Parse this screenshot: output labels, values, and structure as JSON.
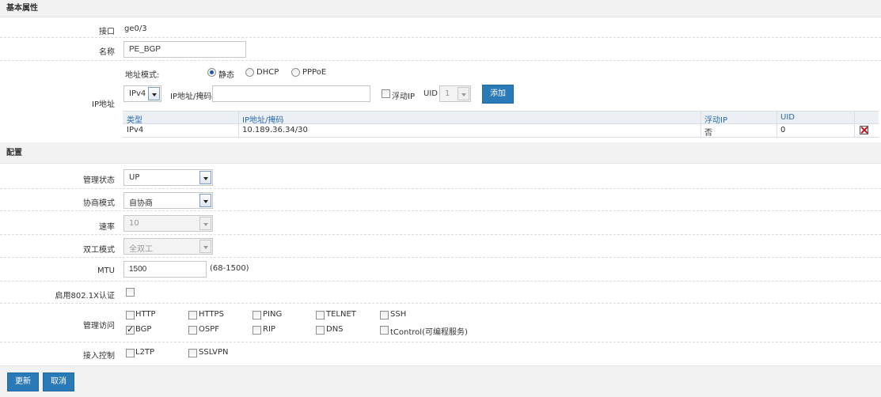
{
  "sections": {
    "basic": "基本属性",
    "config": "配置"
  },
  "interface": {
    "label": "接口",
    "value": "ge0/3"
  },
  "name": {
    "label": "名称",
    "value": "PE_BGP"
  },
  "ip": {
    "label": "IP地址",
    "mode_label": "地址模式:",
    "modes": [
      "静态",
      "DHCP",
      "PPPoE"
    ],
    "selected_mode": "静态",
    "version": "IPv4",
    "addr_label": "IP地址/掩码",
    "addr_value": "",
    "float_label": "浮动IP",
    "float_checked": false,
    "uid_label": "UID",
    "uid_value": "1",
    "add_button": "添加",
    "table": {
      "headers": [
        "类型",
        "IP地址/掩码",
        "浮动IP",
        "UID"
      ],
      "rows": [
        [
          "IPv4",
          "10.189.36.34/30",
          "否",
          "0"
        ]
      ]
    }
  },
  "admin_state": {
    "label": "管理状态",
    "value": "UP"
  },
  "negotiation": {
    "label": "协商模式",
    "value": "自协商"
  },
  "speed": {
    "label": "速率",
    "value": "10"
  },
  "duplex": {
    "label": "双工模式",
    "value": "全双工"
  },
  "mtu": {
    "label": "MTU",
    "value": "1500",
    "hint": "(68-1500)"
  },
  "dot1x": {
    "label": "启用802.1X认证",
    "checked": false
  },
  "mgmt_access": {
    "label": "管理访问",
    "items": [
      {
        "label": "HTTP",
        "checked": false
      },
      {
        "label": "HTTPS",
        "checked": false
      },
      {
        "label": "PING",
        "checked": false
      },
      {
        "label": "TELNET",
        "checked": false
      },
      {
        "label": "SSH",
        "checked": false
      },
      {
        "label": "BGP",
        "checked": true
      },
      {
        "label": "OSPF",
        "checked": false
      },
      {
        "label": "RIP",
        "checked": false
      },
      {
        "label": "DNS",
        "checked": false
      },
      {
        "label": "tControl(可编程服务)",
        "checked": false
      }
    ]
  },
  "access_control": {
    "label": "接入控制",
    "items": [
      {
        "label": "L2TP",
        "checked": false
      },
      {
        "label": "SSLVPN",
        "checked": false
      }
    ]
  },
  "footer": {
    "update": "更新",
    "cancel": "取消"
  }
}
